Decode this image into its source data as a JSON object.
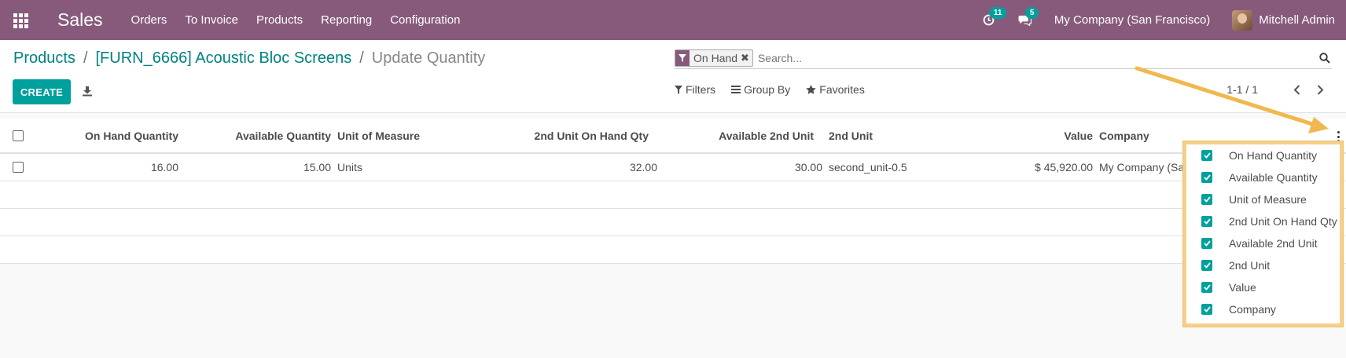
{
  "navbar": {
    "brand": "Sales",
    "menu": [
      "Orders",
      "To Invoice",
      "Products",
      "Reporting",
      "Configuration"
    ],
    "activity_count": "11",
    "messages_count": "5",
    "company": "My Company (San Francisco)",
    "user": "Mitchell Admin"
  },
  "breadcrumb": {
    "items": [
      "Products",
      "[FURN_6666] Acoustic Bloc Screens"
    ],
    "separator": "/",
    "current": "Update Quantity"
  },
  "toolbar": {
    "create_label": "CREATE"
  },
  "search": {
    "facet_label": "On Hand",
    "facet_close": "✖",
    "placeholder": "Search..."
  },
  "filters": {
    "filters_label": "Filters",
    "groupby_label": "Group By",
    "favorites_label": "Favorites"
  },
  "pager": {
    "value": "1-1 / 1"
  },
  "table": {
    "columns": [
      "On Hand Quantity",
      "Available Quantity",
      "Unit of Measure",
      "2nd Unit On Hand Qty",
      "Available 2nd Unit",
      "2nd Unit",
      "Value",
      "Company"
    ],
    "rows": [
      [
        "16.00",
        "15.00",
        "Units",
        "32.00",
        "30.00",
        "second_unit-0.5",
        "$ 45,920.00",
        "My Company (San Francisco)"
      ]
    ]
  },
  "optional_columns": {
    "items": [
      "On Hand Quantity",
      "Available Quantity",
      "Unit of Measure",
      "2nd Unit On Hand Qty",
      "Available 2nd Unit",
      "2nd Unit",
      "Value",
      "Company"
    ],
    "checked": [
      true,
      true,
      true,
      true,
      true,
      true,
      true,
      true
    ]
  },
  "colors": {
    "navbar": "#875a7b",
    "primary": "#00a09d",
    "link": "#00827f",
    "highlight": "#f6d089"
  },
  "icons": [
    "apps-grid-icon",
    "activity-clock-icon",
    "chat-bubble-icon",
    "download-icon",
    "filter-funnel-icon",
    "search-icon",
    "list-icon",
    "star-icon",
    "chevron-left-icon",
    "chevron-right-icon",
    "kebab-vertical-icon",
    "checkmark-icon"
  ]
}
